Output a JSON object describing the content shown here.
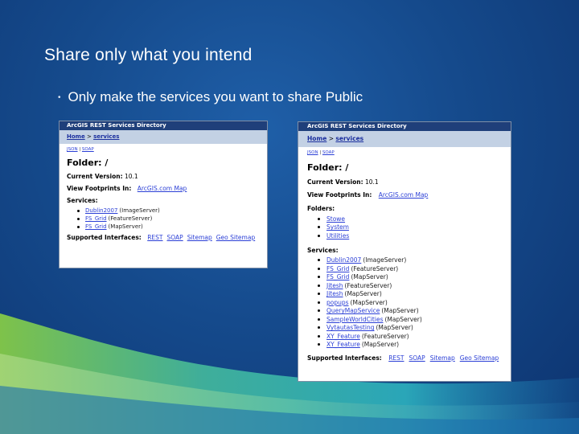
{
  "slide": {
    "title": "Share only what you intend",
    "bullet": "Only make the services you want to share Public",
    "colors": {
      "background": "#154a8c",
      "swoosh_green": "#7ec24a",
      "swoosh_teal": "#2aa6b8"
    }
  },
  "left_panel": {
    "header": "ArcGIS REST Services Directory",
    "breadcrumb_home": "Home",
    "breadcrumb_sep": ">",
    "breadcrumb_current": "services",
    "link_json": "JSON",
    "link_sep": "|",
    "link_soap": "SOAP",
    "folder_heading": "Folder: /",
    "current_version_label": "Current Version:",
    "current_version_value": "10.1",
    "footprints_label": "View Footprints In:",
    "footprints_link": "ArcGIS.com Map",
    "services_label": "Services:",
    "services": [
      {
        "name": "Dublin2007",
        "type": "(ImageServer)"
      },
      {
        "name": "FS_Grid",
        "type": "(FeatureServer)"
      },
      {
        "name": "FS_Grid",
        "type": "(MapServer)"
      }
    ],
    "interfaces_label": "Supported Interfaces:",
    "interfaces": [
      "REST",
      "SOAP",
      "Sitemap",
      "Geo Sitemap"
    ]
  },
  "right_panel": {
    "header": "ArcGIS REST Services Directory",
    "breadcrumb_home": "Home",
    "breadcrumb_sep": ">",
    "breadcrumb_current": "services",
    "link_json": "JSON",
    "link_sep": "|",
    "link_soap": "SOAP",
    "folder_heading": "Folder: /",
    "current_version_label": "Current Version:",
    "current_version_value": "10.1",
    "footprints_label": "View Footprints In:",
    "footprints_link": "ArcGIS.com Map",
    "folders_label": "Folders:",
    "folders": [
      "Stowe",
      "System",
      "Utilities"
    ],
    "services_label": "Services:",
    "services": [
      {
        "name": "Dublin2007",
        "type": "(ImageServer)"
      },
      {
        "name": "FS_Grid",
        "type": "(FeatureServer)"
      },
      {
        "name": "FS_Grid",
        "type": "(MapServer)"
      },
      {
        "name": "Jitesh",
        "type": "(FeatureServer)"
      },
      {
        "name": "Jitesh",
        "type": "(MapServer)"
      },
      {
        "name": "popups",
        "type": "(MapServer)"
      },
      {
        "name": "QueryMapService",
        "type": "(MapServer)"
      },
      {
        "name": "SampleWorldCities",
        "type": "(MapServer)"
      },
      {
        "name": "VytautasTesting",
        "type": "(MapServer)"
      },
      {
        "name": "XY_Feature",
        "type": "(FeatureServer)"
      },
      {
        "name": "XY_Feature",
        "type": "(MapServer)"
      }
    ],
    "interfaces_label": "Supported Interfaces:",
    "interfaces": [
      "REST",
      "SOAP",
      "Sitemap",
      "Geo Sitemap"
    ]
  }
}
